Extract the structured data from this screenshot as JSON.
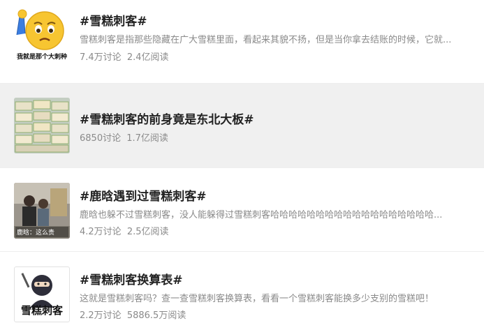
{
  "topics": [
    {
      "title": "#雪糕刺客#",
      "desc": "雪糕刺客是指那些隐藏在广大雪糕里面，看起来其貌不扬，但是当你拿去结账的时候，它就...",
      "discussions": "7.4万讨论",
      "reads": "2.4亿阅读",
      "thumb_caption": "我就是那个大刺种"
    },
    {
      "title": "#雪糕刺客的前身竟是东北大板#",
      "desc": "",
      "discussions": "6850讨论",
      "reads": "1.7亿阅读"
    },
    {
      "title": "#鹿晗遇到过雪糕刺客#",
      "desc": "鹿晗也躲不过雪糕刺客，没人能躲得过雪糕刺客哈哈哈哈哈哈哈哈哈哈哈哈哈哈哈哈哈哈...",
      "discussions": "4.2万讨论",
      "reads": "2.5亿阅读",
      "thumb_caption": "鹿晗：这么贵"
    },
    {
      "title": "#雪糕刺客换算表#",
      "desc": "这就是雪糕刺客吗？查一查雪糕刺客换算表，看看一个雪糕刺客能换多少支别的雪糕吧！",
      "discussions": "2.2万讨论",
      "reads": "5886.5万阅读",
      "thumb_caption": "雪糕刺客"
    }
  ],
  "colors": {
    "highlight_row": "#f0f0f0",
    "title_text": "#222222",
    "meta_text": "#8a8a8a"
  }
}
